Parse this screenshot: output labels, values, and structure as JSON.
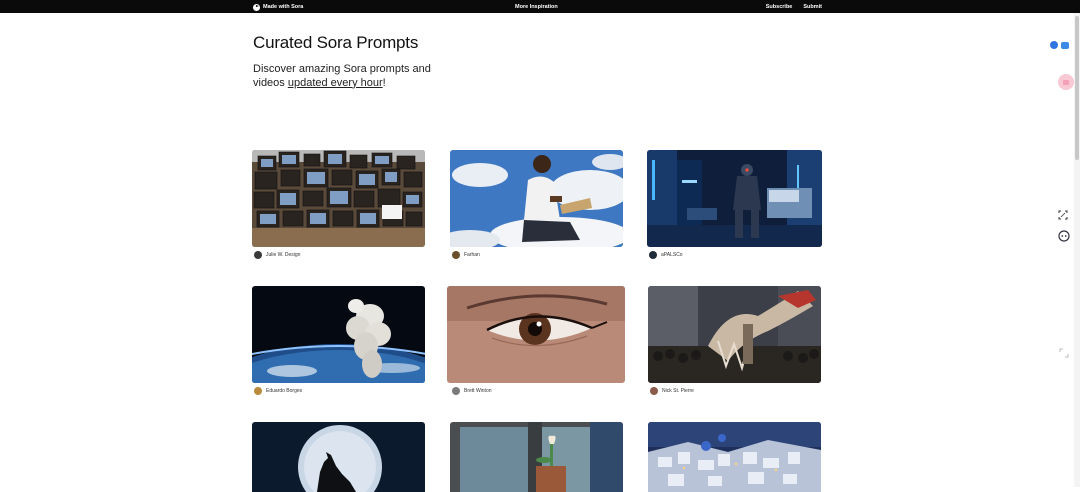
{
  "topbar": {
    "brand": "Made with Sora",
    "center_link": "More Inspiration",
    "subscribe": "Subscribe",
    "submit": "Submit"
  },
  "hero": {
    "title": "Curated Sora Prompts",
    "subtitle_part1": "Discover amazing Sora prompts and videos ",
    "subtitle_link": "updated every hour",
    "subtitle_part2": "!"
  },
  "cards": [
    {
      "author": "Julie W. Design",
      "image": "wall-of-vintage-tvs"
    },
    {
      "author": "Farhan",
      "image": "man-reading-in-clouds"
    },
    {
      "author": "aPALSCo",
      "image": "robot-in-neon-city"
    },
    {
      "author": "Eduardo Borges",
      "image": "smoke-plume-over-earth"
    },
    {
      "author": "Brett Winton",
      "image": "eye-closeup"
    },
    {
      "author": "Nick St. Pierre",
      "image": "dragon-parade"
    },
    {
      "author": "",
      "image": "wolf-howling-at-moon"
    },
    {
      "author": "",
      "image": "plant-on-windowsill"
    },
    {
      "author": "",
      "image": "santorini-at-dusk"
    }
  ],
  "colors": {
    "topbar_bg": "#0a0a0a",
    "page_bg": "#ffffff",
    "text": "#111111"
  },
  "icons": [
    "play-icon",
    "translate-icon",
    "chat-icon",
    "screenshot-icon",
    "robot-icon",
    "expand-icon"
  ]
}
